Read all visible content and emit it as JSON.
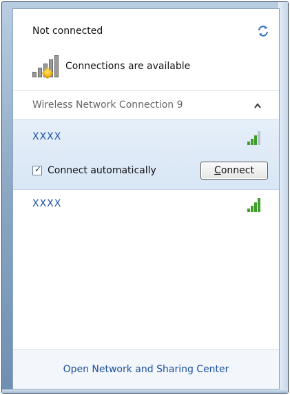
{
  "status": {
    "title": "Not connected",
    "available_label": "Connections are available"
  },
  "section": {
    "title": "Wireless Network Connection 9"
  },
  "networks": [
    {
      "name": "XXXX",
      "signal_bars": 3,
      "connect_automatically_label": "Connect automatically",
      "connect_automatically_checked": true,
      "connect_button_label": "Connect",
      "connect_button_mnemonic": "C",
      "connect_button_rest": "onnect"
    },
    {
      "name": "XXXX",
      "signal_bars": 4
    }
  ],
  "footer": {
    "link_label": "Open Network and Sharing Center"
  },
  "icons": {
    "refresh": "refresh-icon",
    "signal_warning": "signal-warning-icon",
    "collapse": "chevron-up-icon",
    "signal": "wifi-signal-icon"
  },
  "colors": {
    "link": "#1a4fa3",
    "selected_row": "#dde9f6",
    "signal_green": "#3f9e2b"
  }
}
